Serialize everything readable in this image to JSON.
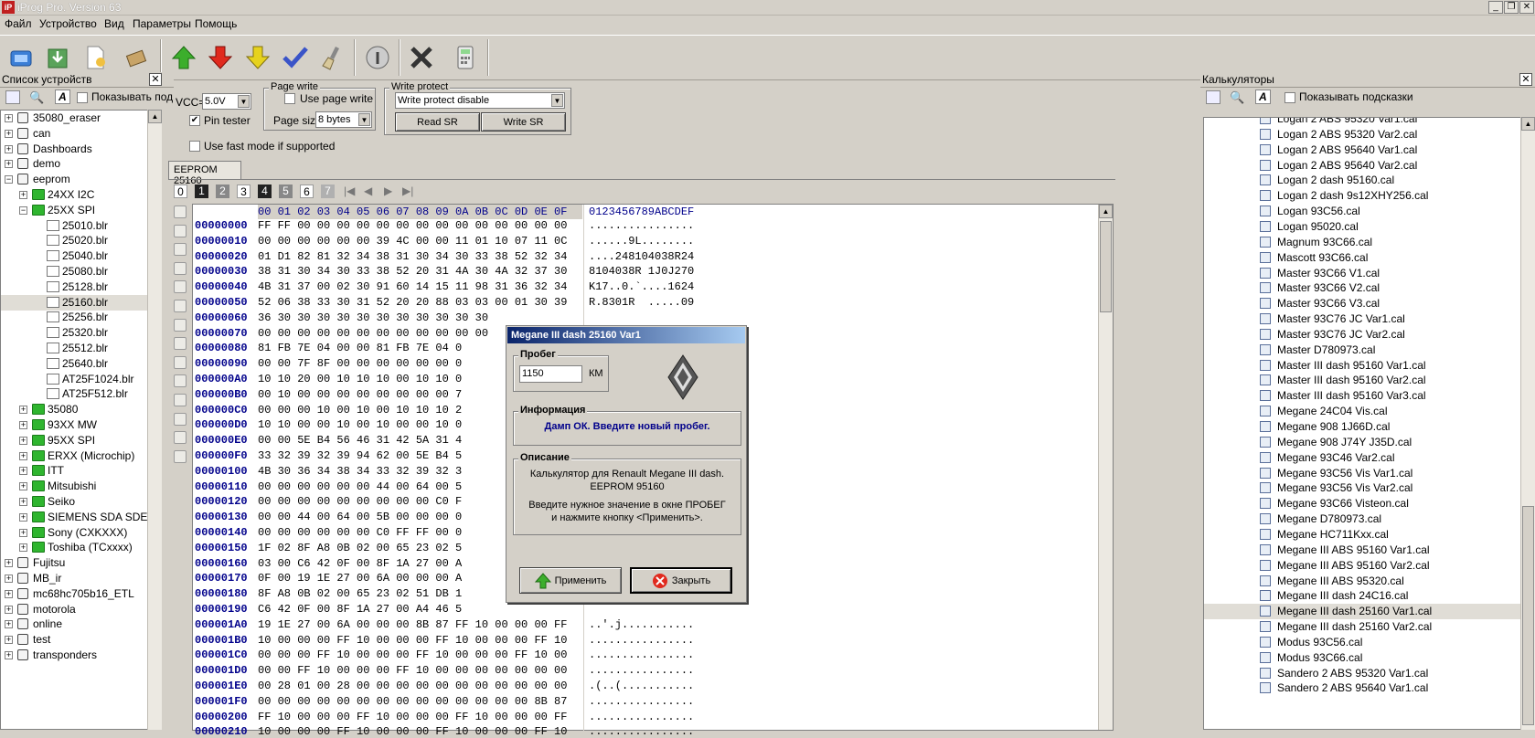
{
  "window": {
    "title": "iProg Pro. Version 63",
    "icon": "iP"
  },
  "menu": [
    "Файл",
    "Устройство",
    "Вид",
    "Параметры",
    "Помощь"
  ],
  "toolbar": {
    "icons": [
      "open-device-icon",
      "save-download-icon",
      "open-file-icon",
      "chip-icon",
      "arrow-up-green-icon",
      "arrow-down-red-icon",
      "arrow-down-yellow-icon",
      "checkmark-icon",
      "erase-brush-icon",
      "info-icon",
      "cancel-icon",
      "calculator-icon"
    ]
  },
  "left_panel": {
    "title": "Список устройств",
    "show_hints": "Показывать под",
    "items": [
      {
        "label": "35080_eraser",
        "level": 0,
        "exp": "+",
        "icon": "eraser"
      },
      {
        "label": "can",
        "level": 0,
        "exp": "+",
        "icon": "can"
      },
      {
        "label": "Dashboards",
        "level": 0,
        "exp": "+",
        "icon": "gauge"
      },
      {
        "label": "demo",
        "level": 0,
        "exp": "+",
        "icon": "folder-plain"
      },
      {
        "label": "eeprom",
        "level": 0,
        "exp": "−",
        "icon": "chip"
      },
      {
        "label": "24XX I2C",
        "level": 1,
        "exp": "+",
        "icon": "folder"
      },
      {
        "label": "25XX SPI",
        "level": 1,
        "exp": "−",
        "icon": "folder"
      },
      {
        "label": "25010.blr",
        "level": 2,
        "exp": "",
        "icon": "file"
      },
      {
        "label": "25020.blr",
        "level": 2,
        "exp": "",
        "icon": "file"
      },
      {
        "label": "25040.blr",
        "level": 2,
        "exp": "",
        "icon": "file"
      },
      {
        "label": "25080.blr",
        "level": 2,
        "exp": "",
        "icon": "file"
      },
      {
        "label": "25128.blr",
        "level": 2,
        "exp": "",
        "icon": "file"
      },
      {
        "label": "25160.blr",
        "level": 2,
        "exp": "",
        "icon": "file",
        "selected": true
      },
      {
        "label": "25256.blr",
        "level": 2,
        "exp": "",
        "icon": "file"
      },
      {
        "label": "25320.blr",
        "level": 2,
        "exp": "",
        "icon": "file"
      },
      {
        "label": "25512.blr",
        "level": 2,
        "exp": "",
        "icon": "file"
      },
      {
        "label": "25640.blr",
        "level": 2,
        "exp": "",
        "icon": "file"
      },
      {
        "label": "AT25F1024.blr",
        "level": 2,
        "exp": "",
        "icon": "file"
      },
      {
        "label": "AT25F512.blr",
        "level": 2,
        "exp": "",
        "icon": "file"
      },
      {
        "label": "35080",
        "level": 1,
        "exp": "+",
        "icon": "folder"
      },
      {
        "label": "93XX MW",
        "level": 1,
        "exp": "+",
        "icon": "folder"
      },
      {
        "label": "95XX SPI",
        "level": 1,
        "exp": "+",
        "icon": "folder"
      },
      {
        "label": "ERXX (Microchip)",
        "level": 1,
        "exp": "+",
        "icon": "folder"
      },
      {
        "label": "ITT",
        "level": 1,
        "exp": "+",
        "icon": "folder"
      },
      {
        "label": "Mitsubishi",
        "level": 1,
        "exp": "+",
        "icon": "folder"
      },
      {
        "label": "Seiko",
        "level": 1,
        "exp": "+",
        "icon": "folder"
      },
      {
        "label": "SIEMENS SDA SDE",
        "level": 1,
        "exp": "+",
        "icon": "folder"
      },
      {
        "label": "Sony (CXKXXX)",
        "level": 1,
        "exp": "+",
        "icon": "folder"
      },
      {
        "label": "Toshiba (TCxxxx)",
        "level": 1,
        "exp": "+",
        "icon": "folder"
      },
      {
        "label": "Fujitsu",
        "level": 0,
        "exp": "+",
        "icon": "chip"
      },
      {
        "label": "MB_ir",
        "level": 0,
        "exp": "+",
        "icon": "chip"
      },
      {
        "label": "mc68hc705b16_ETL",
        "level": 0,
        "exp": "+",
        "icon": "chip"
      },
      {
        "label": "motorola",
        "level": 0,
        "exp": "+",
        "icon": "chip"
      },
      {
        "label": "online",
        "level": 0,
        "exp": "+",
        "icon": "cloud"
      },
      {
        "label": "test",
        "level": 0,
        "exp": "+",
        "icon": "folder-plain"
      },
      {
        "label": "transponders",
        "level": 0,
        "exp": "+",
        "icon": "transponder"
      }
    ]
  },
  "settings": {
    "vcc_label": "VCC=",
    "vcc_value": "5.0V",
    "pin_tester": "Pin tester",
    "fast_mode": "Use fast mode if supported",
    "page_write_title": "Page write",
    "use_page_write": "Use page write",
    "page_size_label": "Page size",
    "page_size_value": "8 bytes",
    "write_protect_title": "Write protect",
    "write_protect_value": "Write protect disable",
    "read_sr": "Read SR",
    "write_sr": "Write SR"
  },
  "hex": {
    "tab": "EEPROM 25160",
    "pages": [
      "0",
      "1",
      "2",
      "3",
      "4",
      "5",
      "6",
      "7"
    ],
    "header": "00 01 02 03 04 05 06 07 08 09 0A 0B 0C 0D 0E 0F",
    "ascii_header": "0123456789ABCDEF",
    "rows": [
      {
        "addr": "00000000",
        "bytes": "FF FF 00 00 00 00 00 00 00 00 00 00 00 00 00 00",
        "ascii": "................"
      },
      {
        "addr": "00000010",
        "bytes": "00 00 00 00 00 00 39 4C 00 00 11 01 10 07 11 0C",
        "ascii": "......9L........"
      },
      {
        "addr": "00000020",
        "bytes": "01 D1 82 81 32 34 38 31 30 34 30 33 38 52 32 34",
        "ascii": "....248104038R24"
      },
      {
        "addr": "00000030",
        "bytes": "38 31 30 34 30 33 38 52 20 31 4A 30 4A 32 37 30",
        "ascii": "8104038R 1J0J270"
      },
      {
        "addr": "00000040",
        "bytes": "4B 31 37 00 02 30 91 60 14 15 11 98 31 36 32 34",
        "ascii": "K17..0.`....1624"
      },
      {
        "addr": "00000050",
        "bytes": "52 06 38 33 30 31 52 20 20 88 03 03 00 01 30 39",
        "ascii": "R.8301R  .....09"
      },
      {
        "addr": "00000060",
        "bytes": "36 30 30 30 30 30 30 30 30 30 30 30",
        "ascii": ""
      },
      {
        "addr": "00000070",
        "bytes": "00 00 00 00 00 00 00 00 00 00 00 00",
        "ascii": ""
      },
      {
        "addr": "00000080",
        "bytes": "81 FB 7E 04 00 00 81 FB 7E 04 0",
        "ascii": ""
      },
      {
        "addr": "00000090",
        "bytes": "00 00 7F 8F 00 00 00 00 00 00 0",
        "ascii": ""
      },
      {
        "addr": "000000A0",
        "bytes": "10 10 20 00 10 10 10 00 10 10 0",
        "ascii": ""
      },
      {
        "addr": "000000B0",
        "bytes": "00 10 00 00 00 00 00 00 00 00 7",
        "ascii": ""
      },
      {
        "addr": "000000C0",
        "bytes": "00 00 00 10 00 10 00 10 10 10 2",
        "ascii": ""
      },
      {
        "addr": "000000D0",
        "bytes": "10 10 00 00 10 00 10 00 00 10 0",
        "ascii": ""
      },
      {
        "addr": "000000E0",
        "bytes": "00 00 5E B4 56 46 31 42 5A 31 4",
        "ascii": ""
      },
      {
        "addr": "000000F0",
        "bytes": "33 32 39 32 39 94 62 00 5E B4 5",
        "ascii": ""
      },
      {
        "addr": "00000100",
        "bytes": "4B 30 36 34 38 34 33 32 39 32 3",
        "ascii": ""
      },
      {
        "addr": "00000110",
        "bytes": "00 00 00 00 00 00 44 00 64 00 5",
        "ascii": ""
      },
      {
        "addr": "00000120",
        "bytes": "00 00 00 00 00 00 00 00 00 C0 F",
        "ascii": ""
      },
      {
        "addr": "00000130",
        "bytes": "00 00 44 00 64 00 5B 00 00 00 0",
        "ascii": ""
      },
      {
        "addr": "00000140",
        "bytes": "00 00 00 00 00 00 C0 FF FF 00 0",
        "ascii": ""
      },
      {
        "addr": "00000150",
        "bytes": "1F 02 8F A8 0B 02 00 65 23 02 5",
        "ascii": ""
      },
      {
        "addr": "00000160",
        "bytes": "03 00 C6 42 0F 00 8F 1A 27 00 A",
        "ascii": ""
      },
      {
        "addr": "00000170",
        "bytes": "0F 00 19 1E 27 00 6A 00 00 00 A",
        "ascii": ""
      },
      {
        "addr": "00000180",
        "bytes": "8F A8 0B 02 00 65 23 02 51 DB 1",
        "ascii": ""
      },
      {
        "addr": "00000190",
        "bytes": "C6 42 0F 00 8F 1A 27 00 A4 46 5",
        "ascii": ""
      },
      {
        "addr": "000001A0",
        "bytes": "19 1E 27 00 6A 00 00 00 8B 87 FF 10 00 00 00 FF",
        "ascii": "..'.j..........."
      },
      {
        "addr": "000001B0",
        "bytes": "10 00 00 00 FF 10 00 00 00 FF 10 00 00 00 FF 10",
        "ascii": "................"
      },
      {
        "addr": "000001C0",
        "bytes": "00 00 00 FF 10 00 00 00 FF 10 00 00 00 FF 10 00",
        "ascii": "................"
      },
      {
        "addr": "000001D0",
        "bytes": "00 00 FF 10 00 00 00 FF 10 00 00 00 00 00 00 00",
        "ascii": "................"
      },
      {
        "addr": "000001E0",
        "bytes": "00 28 01 00 28 00 00 00 00 00 00 00 00 00 00 00",
        "ascii": ".(..(..........."
      },
      {
        "addr": "000001F0",
        "bytes": "00 00 00 00 00 00 00 00 00 00 00 00 00 00 8B 87",
        "ascii": "................"
      },
      {
        "addr": "00000200",
        "bytes": "FF 10 00 00 00 FF 10 00 00 00 FF 10 00 00 00 FF",
        "ascii": "................"
      },
      {
        "addr": "00000210",
        "bytes": "10 00 00 00 FF 10 00 00 00 FF 10 00 00 00 FF 10",
        "ascii": "................"
      }
    ]
  },
  "dialog": {
    "title": "Megane III dash 25160 Var1",
    "mileage_title": "Пробег",
    "mileage_value": "1150",
    "mileage_unit": "КМ",
    "info_title": "Информация",
    "info_text": "Дамп ОК. Введите новый пробег.",
    "desc_title": "Описание",
    "desc_line1": "Калькулятор для Renault Megane III dash.",
    "desc_line2": "EEPROM 95160",
    "desc_line3": "Введите нужное значение в окне ПРОБЕГ",
    "desc_line4": "и нажмите кнопку <Применить>.",
    "apply": "Применить",
    "close": "Закрыть"
  },
  "right_panel": {
    "title": "Калькуляторы",
    "show_hints": "Показывать подсказки",
    "items": [
      "Logan 2 ABS 95320 Var1.cal",
      "Logan 2 ABS 95320 Var2.cal",
      "Logan 2 ABS 95640 Var1.cal",
      "Logan 2 ABS 95640 Var2.cal",
      "Logan 2 dash 95160.cal",
      "Logan 2 dash 9s12XHY256.cal",
      "Logan 93C56.cal",
      "Logan 95020.cal",
      "Magnum 93C66.cal",
      "Mascott 93C66.cal",
      "Master 93C66 V1.cal",
      "Master 93C66 V2.cal",
      "Master 93C66 V3.cal",
      "Master 93C76 JC Var1.cal",
      "Master 93C76 JC Var2.cal",
      "Master D780973.cal",
      "Master III dash 95160 Var1.cal",
      "Master III dash 95160 Var2.cal",
      "Master III dash 95160 Var3.cal",
      "Megane 24C04 Vis.cal",
      "Megane 908 1J66D.cal",
      "Megane 908 J74Y J35D.cal",
      "Megane 93C46 Var2.cal",
      "Megane 93C56 Vis Var1.cal",
      "Megane 93C56 Vis Var2.cal",
      "Megane 93C66 Visteon.cal",
      "Megane D780973.cal",
      "Megane HC711Kxx.cal",
      "Megane III ABS 95160 Var1.cal",
      "Megane III ABS 95160 Var2.cal",
      "Megane III ABS 95320.cal",
      "Megane III dash 24C16.cal",
      "Megane III dash 25160 Var1.cal",
      "Megane III dash 25160 Var2.cal",
      "Modus 93C56.cal",
      "Modus 93C66.cal",
      "Sandero 2 ABS 95320 Var1.cal",
      "Sandero 2 ABS 95640 Var1.cal"
    ],
    "selected_index": 32
  }
}
